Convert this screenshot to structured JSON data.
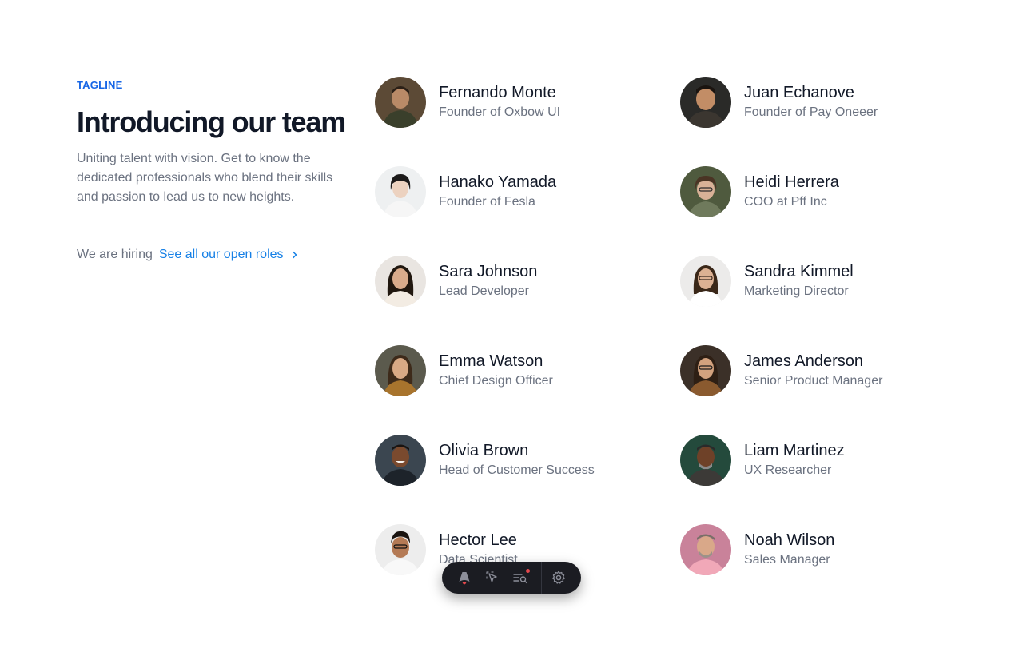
{
  "intro": {
    "tagline": "TAGLINE",
    "title": "Introducing our team",
    "description": "Uniting talent with vision. Get to know the dedicated professionals who blend their skills and passion to lead us to new heights.",
    "hiring_text": "We are hiring",
    "roles_link": "See all our open roles"
  },
  "team": [
    {
      "name": "Fernando Monte",
      "role": "Founder of Oxbow UI"
    },
    {
      "name": "Juan Echanove",
      "role": "Founder of Pay Oneeer"
    },
    {
      "name": "Hanako Yamada",
      "role": "Founder of Fesla"
    },
    {
      "name": "Heidi Herrera",
      "role": "COO at Pff Inc"
    },
    {
      "name": "Sara Johnson",
      "role": "Lead Developer"
    },
    {
      "name": "Sandra Kimmel",
      "role": "Marketing Director"
    },
    {
      "name": "Emma Watson",
      "role": "Chief Design Officer"
    },
    {
      "name": "James Anderson",
      "role": "Senior Product Manager"
    },
    {
      "name": "Olivia Brown",
      "role": "Head of Customer Success"
    },
    {
      "name": "Liam Martinez",
      "role": "UX Researcher"
    },
    {
      "name": "Hector Lee",
      "role": "Data Scientist"
    },
    {
      "name": "Noah Wilson",
      "role": "Sales Manager"
    }
  ],
  "toolbar": {
    "items": [
      "astro-logo-icon",
      "inspect-cursor-icon",
      "audit-list-icon",
      "settings-gear-icon"
    ]
  },
  "colors": {
    "accent": "#1766e6",
    "link": "#1680e6",
    "muted_text": "#6b7280",
    "heading": "#111827",
    "toolbar_bg": "#1b1c22"
  }
}
